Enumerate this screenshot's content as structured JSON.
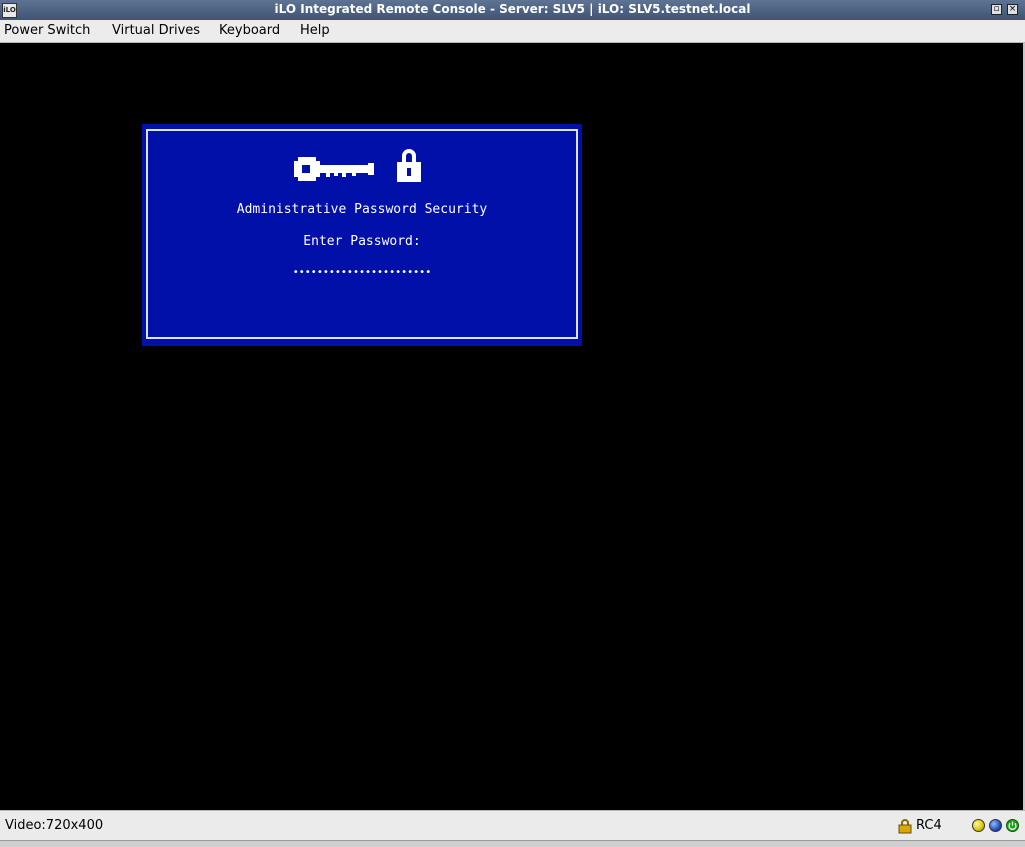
{
  "window": {
    "title": "iLO Integrated Remote Console - Server: SLV5 | iLO: SLV5.testnet.local",
    "app_icon_text": "iLO"
  },
  "menu": {
    "items": [
      {
        "label": "Power Switch"
      },
      {
        "label": "Virtual Drives"
      },
      {
        "label": "Keyboard"
      },
      {
        "label": "Help"
      }
    ]
  },
  "bios": {
    "icons": [
      "key-icon",
      "padlock-icon"
    ],
    "heading": "Administrative Password Security",
    "prompt": "Enter Password:",
    "password_mask": "•••••••••••••••••••••••"
  },
  "status": {
    "video": "Video:720x400",
    "cipher": "RC4",
    "indicators": [
      {
        "name": "yellow-led-icon",
        "color": "#d8c800"
      },
      {
        "name": "blue-led-icon",
        "color": "#1f4fc0"
      },
      {
        "name": "power-led-icon",
        "color": "#1aa31a"
      }
    ]
  }
}
